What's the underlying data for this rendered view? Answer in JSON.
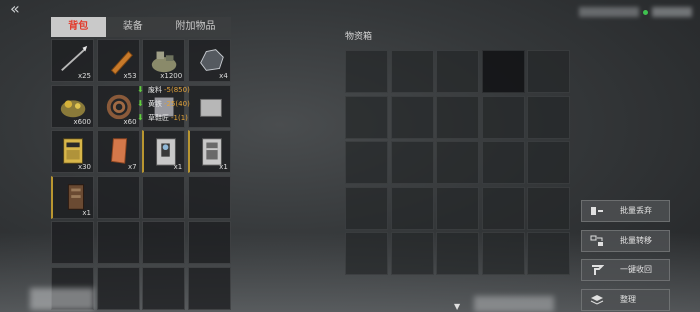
{
  "header": {
    "back_icon": "double-chevron-left-icon"
  },
  "tabs": [
    {
      "label": "背包",
      "active": true
    },
    {
      "label": "装备",
      "active": false
    },
    {
      "label": "附加物品",
      "active": false
    }
  ],
  "backpack": {
    "items": [
      {
        "icon": "spear-icon",
        "qty": "x25",
        "marked": false
      },
      {
        "icon": "plank-icon",
        "qty": "x53",
        "marked": false
      },
      {
        "icon": "scrap-pile-icon",
        "qty": "x1200",
        "marked": false
      },
      {
        "icon": "ore-icon",
        "qty": "x4",
        "marked": false
      },
      {
        "icon": "gold-ore-icon",
        "qty": "x600",
        "marked": false
      },
      {
        "icon": "rope-coil-icon",
        "qty": "x60",
        "marked": false
      },
      {
        "icon": "cloth-icon",
        "qty": "",
        "marked": false
      },
      {
        "icon": "crate-icon",
        "qty": "",
        "marked": false
      },
      {
        "icon": "manual-icon",
        "qty": "x30",
        "marked": false
      },
      {
        "icon": "leather-icon",
        "qty": "x7",
        "marked": false
      },
      {
        "icon": "lantern-kit-icon",
        "qty": "x1",
        "marked": true
      },
      {
        "icon": "cabinet-kit-icon",
        "qty": "x1",
        "marked": true
      },
      {
        "icon": "shelf-kit-icon",
        "qty": "x1",
        "marked": true
      },
      {
        "icon": "",
        "qty": "",
        "marked": false
      },
      {
        "icon": "",
        "qty": "",
        "marked": false
      },
      {
        "icon": "",
        "qty": "",
        "marked": false
      },
      {
        "icon": "",
        "qty": "",
        "marked": false
      },
      {
        "icon": "",
        "qty": "",
        "marked": false
      },
      {
        "icon": "",
        "qty": "",
        "marked": false
      },
      {
        "icon": "",
        "qty": "",
        "marked": false
      },
      {
        "icon": "",
        "qty": "",
        "marked": false
      },
      {
        "icon": "",
        "qty": "",
        "marked": false
      },
      {
        "icon": "",
        "qty": "",
        "marked": false
      },
      {
        "icon": "",
        "qty": "",
        "marked": false
      }
    ]
  },
  "tooltip": {
    "rows": [
      {
        "label": "废料",
        "value": "-5(850)"
      },
      {
        "label": "黄铁",
        "value": "-25(40)"
      },
      {
        "label": "草鞋匠",
        "value": "-1(1)"
      }
    ]
  },
  "storage": {
    "title": "物资箱",
    "dark_cells": [
      3
    ]
  },
  "actions": [
    {
      "icon": "discard-icon",
      "label": "批量丢弃"
    },
    {
      "icon": "transfer-icon",
      "label": "批量转移"
    },
    {
      "icon": "collect-icon",
      "label": "一键收回"
    },
    {
      "icon": "sort-icon",
      "label": "整理"
    }
  ],
  "colors": {
    "active_tab_text": "#e23b2c",
    "cost_value": "#e1a23a",
    "ready_arrow": "#5fcf3c",
    "marked_border": "#b99630"
  }
}
